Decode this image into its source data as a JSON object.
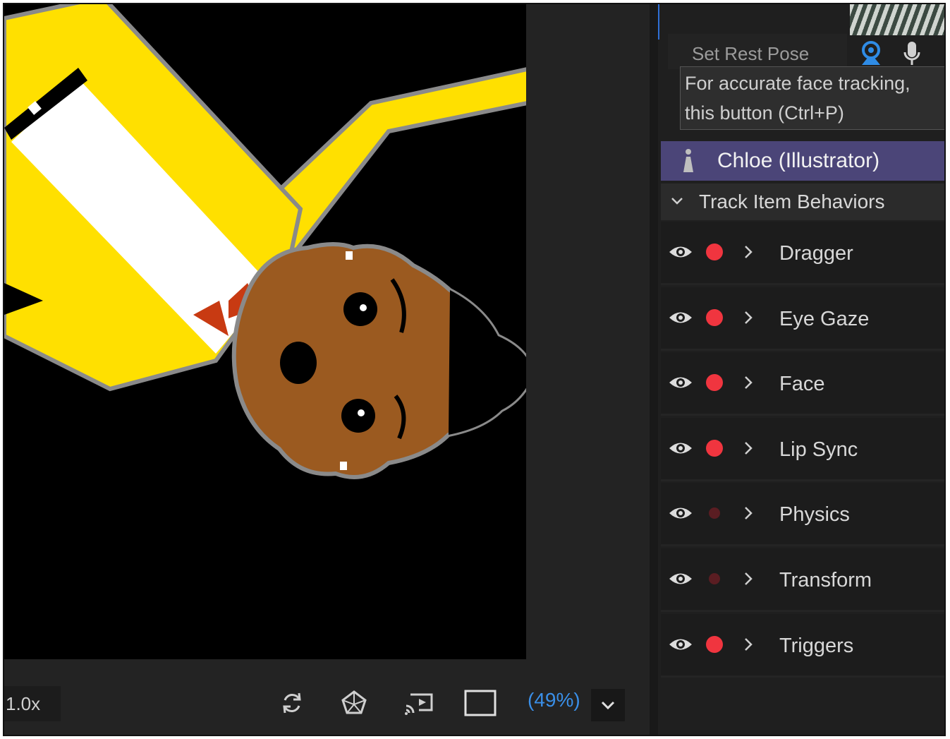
{
  "scene": {
    "speed": "1.0x",
    "zoom_percent": "(49%)",
    "toolbar_icons": [
      "refresh-icon",
      "3d-cube-icon",
      "cast-preview-icon",
      "frame-icon",
      "chevron-down-icon"
    ]
  },
  "camera": {
    "set_rest_pose": "Set Rest Pose",
    "tooltip_line1": "For accurate face tracking,",
    "tooltip_line2": "this button (Ctrl+P)",
    "icons": [
      "webcam-icon",
      "microphone-icon"
    ]
  },
  "puppet": {
    "name": "Chloe (Illustrator)"
  },
  "section": {
    "title": "Track Item Behaviors",
    "expanded": true
  },
  "behaviors": [
    {
      "name": "Dragger",
      "armed": true
    },
    {
      "name": "Eye Gaze",
      "armed": true
    },
    {
      "name": "Face",
      "armed": true
    },
    {
      "name": "Lip Sync",
      "armed": true
    },
    {
      "name": "Physics",
      "armed": false
    },
    {
      "name": "Transform",
      "armed": false
    },
    {
      "name": "Triggers",
      "armed": true
    }
  ],
  "colors": {
    "accent": "#3a8fe8",
    "puppet_row": "#4b4578",
    "record_armed": "#f0353f",
    "record_disarmed": "#5a1d22",
    "puppet_shirt": "#ffe000",
    "puppet_skin": "#9b5a20",
    "bowtie": "#c83a12"
  }
}
